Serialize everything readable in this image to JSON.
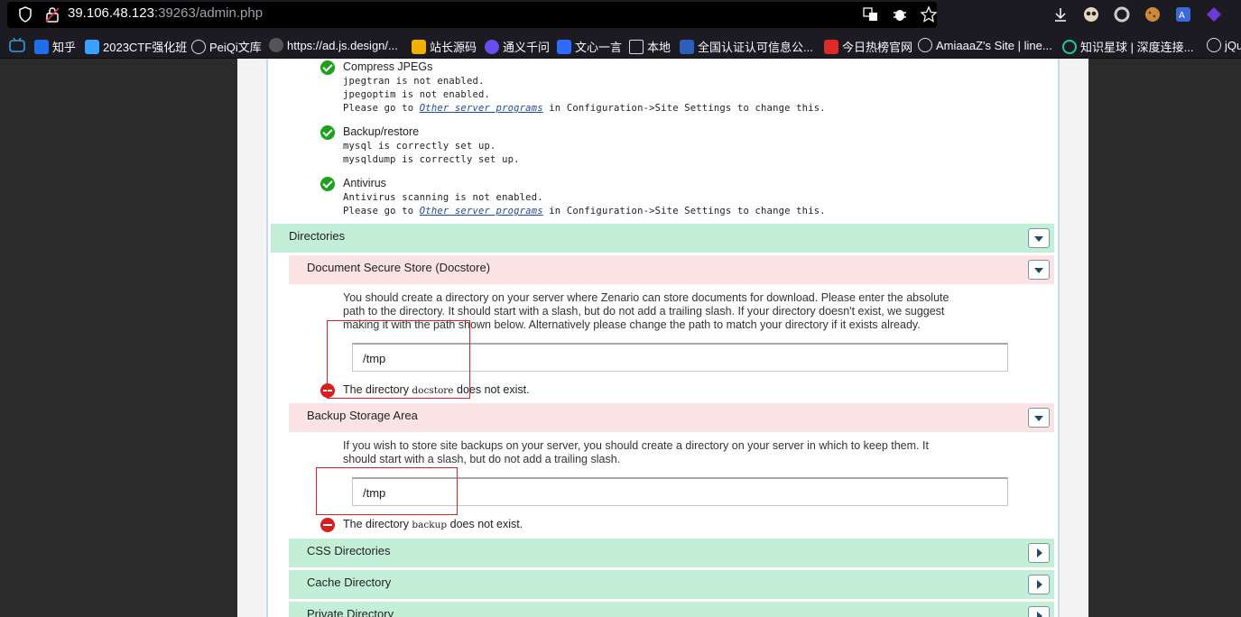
{
  "browser": {
    "url_host": "39.106.48.123",
    "url_rest": ":39263/admin.php",
    "bookmarks": [
      {
        "label": "知乎",
        "color": "#1e6fe8"
      },
      {
        "label": "2023CTF强化班",
        "color": "#3ba0ff"
      },
      {
        "label": "PeiQi文库",
        "color": "#888888"
      },
      {
        "label": "https://ad.js.design/...",
        "color": "#aaaaaa"
      },
      {
        "label": "站长源码",
        "color": "#f0b000"
      },
      {
        "label": "通义千问",
        "color": "#6a4cf0"
      },
      {
        "label": "文心一言",
        "color": "#2f6bff"
      },
      {
        "label": "本地",
        "color": "#cccccc"
      },
      {
        "label": "全国认证认可信息公...",
        "color": "#2d5fb8"
      },
      {
        "label": "今日热榜官网",
        "color": "#e02828"
      },
      {
        "label": "AmiaaaZ's Site | line...",
        "color": "#888888"
      },
      {
        "label": "知识星球 | 深度连接...",
        "color": "#20c997"
      },
      {
        "label": "jQu",
        "color": "#888888"
      }
    ]
  },
  "checks": [
    {
      "title": "Compress JPEGs",
      "lines": [
        "jpegtran is not enabled.",
        "jpegoptim is not enabled."
      ],
      "link_pre": "Please go to ",
      "link": "Other server programs",
      "link_post": " in Configuration->Site Settings to change this."
    },
    {
      "title": "Backup/restore",
      "lines": [
        "mysql is correctly set up.",
        "mysqldump is correctly set up."
      ]
    },
    {
      "title": "Antivirus",
      "lines": [
        "Antivirus scanning is not enabled."
      ],
      "link_pre": "Please go to ",
      "link": "Other server programs",
      "link_post": " in Configuration->Site Settings to change this."
    }
  ],
  "directories": {
    "label": "Directories",
    "docstore": {
      "label": "Document Secure Store (Docstore)",
      "description_lines": [
        "You should create a directory on your server where Zenario can store documents for download. Please enter the absolute",
        "path to the directory. It should start with a slash, but do not add a trailing slash. If your directory doesn't exist, we suggest",
        "making it with the path shown below. Alternatively please change the path to match your directory if it exists already."
      ],
      "value": "/tmp",
      "error_pre": "The directory ",
      "error_code": "docstore",
      "error_post": " does not exist."
    },
    "backup": {
      "label": "Backup Storage Area",
      "description_lines": [
        "If you wish to store site backups on your server, you should create a directory on your server in which to keep them. It",
        "should start with a slash, but do not add a trailing slash."
      ],
      "value": "/tmp",
      "error_pre": "The directory ",
      "error_code": "backup",
      "error_post": " does not exist."
    },
    "css": {
      "label": "CSS Directories"
    },
    "cache": {
      "label": "Cache Directory"
    },
    "private": {
      "label": "Private Directory"
    }
  }
}
